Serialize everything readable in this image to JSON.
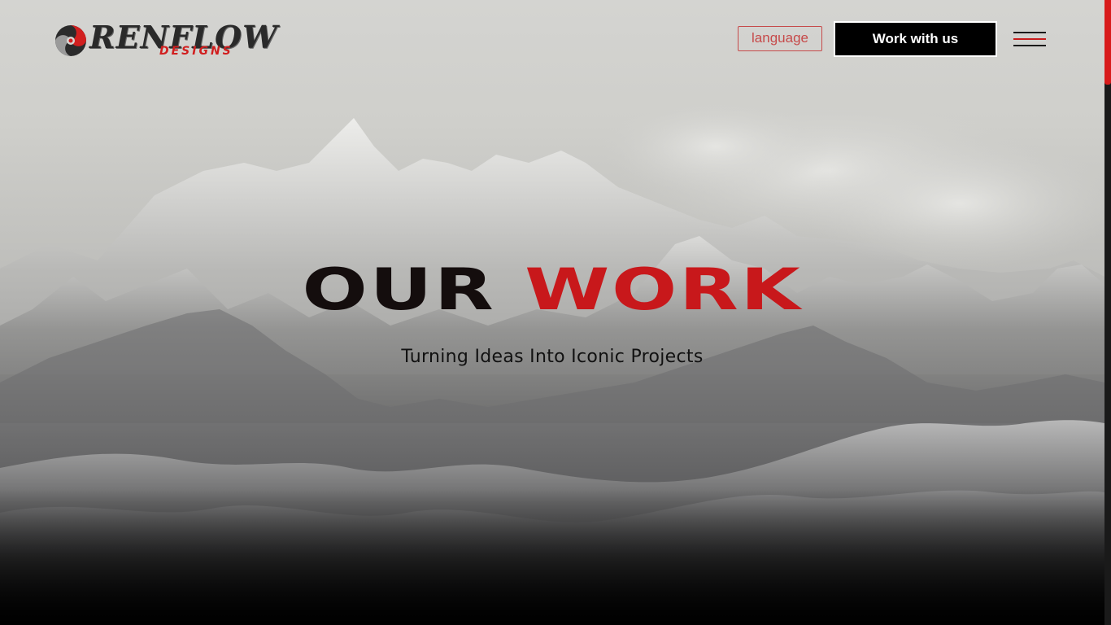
{
  "brand": {
    "name_main": "RENFLOW",
    "name_sub": "DESIGNS",
    "accent_color": "#d11f1f"
  },
  "header": {
    "language_label": "language",
    "cta_label": "Work with us",
    "menu_icon": "hamburger-menu-icon"
  },
  "hero": {
    "title_part1": "OUR",
    "title_part2": "WORK",
    "subtitle": "Turning Ideas Into Iconic Projects",
    "background": "misty-mountains-image"
  },
  "scroll": {
    "thumb_color": "#d81b1b"
  }
}
